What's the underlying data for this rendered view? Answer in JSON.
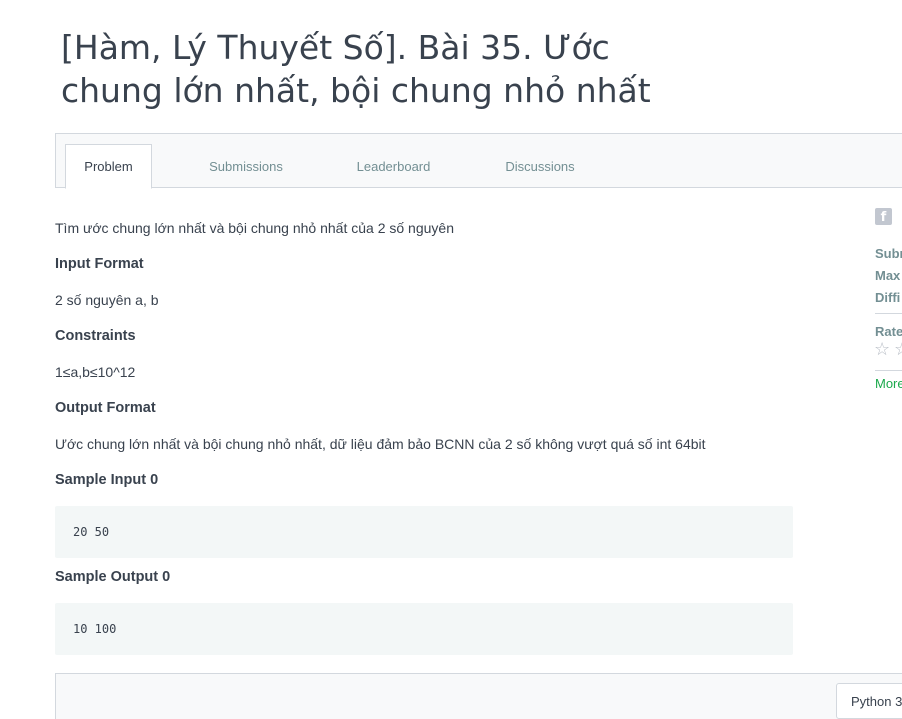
{
  "challenge": {
    "title": "[Hàm, Lý Thuyết Số]. Bài 35. Ước chung lớn nhất, bội chung nhỏ nhất"
  },
  "tabs": [
    {
      "label": "Problem",
      "active": true
    },
    {
      "label": "Submissions",
      "active": false
    },
    {
      "label": "Leaderboard",
      "active": false
    },
    {
      "label": "Discussions",
      "active": false
    }
  ],
  "problem": {
    "description": "Tìm ước chung lớn nhất và bội chung nhỏ nhất của 2 số nguyên",
    "input_format_heading": "Input Format",
    "input_format": "2 số nguyên a, b",
    "constraints_heading": "Constraints",
    "constraints": "1≤a,b≤10^12",
    "output_format_heading": "Output Format",
    "output_format": "Ước chung lớn nhất và bội chung nhỏ nhất, dữ liệu đảm bảo BCNN của 2 số không vượt quá số int 64bit",
    "sample_input_heading": "Sample Input 0",
    "sample_input": "20 50",
    "sample_output_heading": "Sample Output 0",
    "sample_output": "10 100"
  },
  "sidebar": {
    "share_icon": "facebook-icon",
    "submitted_label": "Subm",
    "max_score_label": "Max",
    "difficulty_label": "Diffi",
    "rate_label": "Rate",
    "more_link": "More"
  },
  "editor": {
    "language": "Python 3"
  },
  "colors": {
    "text": "#39424e",
    "muted": "#738f93",
    "border": "#d3d8de",
    "code_bg": "#f3f7f7",
    "link": "#1ba94c"
  }
}
